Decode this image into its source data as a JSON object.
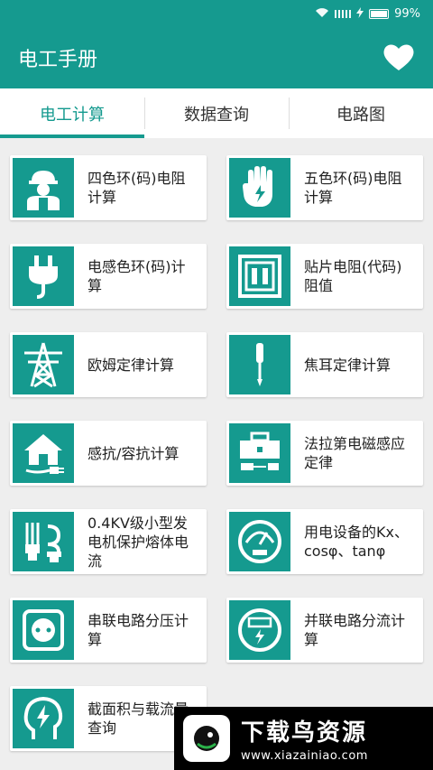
{
  "status_bar": {
    "battery": "99%"
  },
  "app_bar": {
    "title": "电工手册"
  },
  "tabs": [
    {
      "label": "电工计算",
      "active": true
    },
    {
      "label": "数据查询",
      "active": false
    },
    {
      "label": "电路图",
      "active": false
    }
  ],
  "cards": [
    {
      "label": "四色环(码)电阻计算",
      "icon": "worker-icon"
    },
    {
      "label": "五色环(码)电阻计算",
      "icon": "glove-icon"
    },
    {
      "label": "电感色环(码)计算",
      "icon": "plug-icon"
    },
    {
      "label": "贴片电阻(代码)阻值",
      "icon": "socket-panel-icon"
    },
    {
      "label": "欧姆定律计算",
      "icon": "power-tower-icon"
    },
    {
      "label": "焦耳定律计算",
      "icon": "screwdriver-icon"
    },
    {
      "label": "感抗/容抗计算",
      "icon": "house-plug-icon"
    },
    {
      "label": "法拉第电磁感应定律",
      "icon": "toolbox-icon"
    },
    {
      "label": "0.4KV级小型发电机保护熔体电流",
      "icon": "bulbs-icon"
    },
    {
      "label": "用电设备的Kx、cosφ、tanφ",
      "icon": "meter-gauge-icon"
    },
    {
      "label": "串联电路分压计算",
      "icon": "outlet-icon"
    },
    {
      "label": "并联电路分流计算",
      "icon": "electric-meter-icon"
    },
    {
      "label": "截面积与载流量查询",
      "icon": "head-bolt-icon"
    }
  ],
  "watermark": {
    "title": "下载鸟资源",
    "url": "www.xiazainiao.com"
  },
  "colors": {
    "primary": "#159a8f",
    "background": "#eeeeee"
  }
}
